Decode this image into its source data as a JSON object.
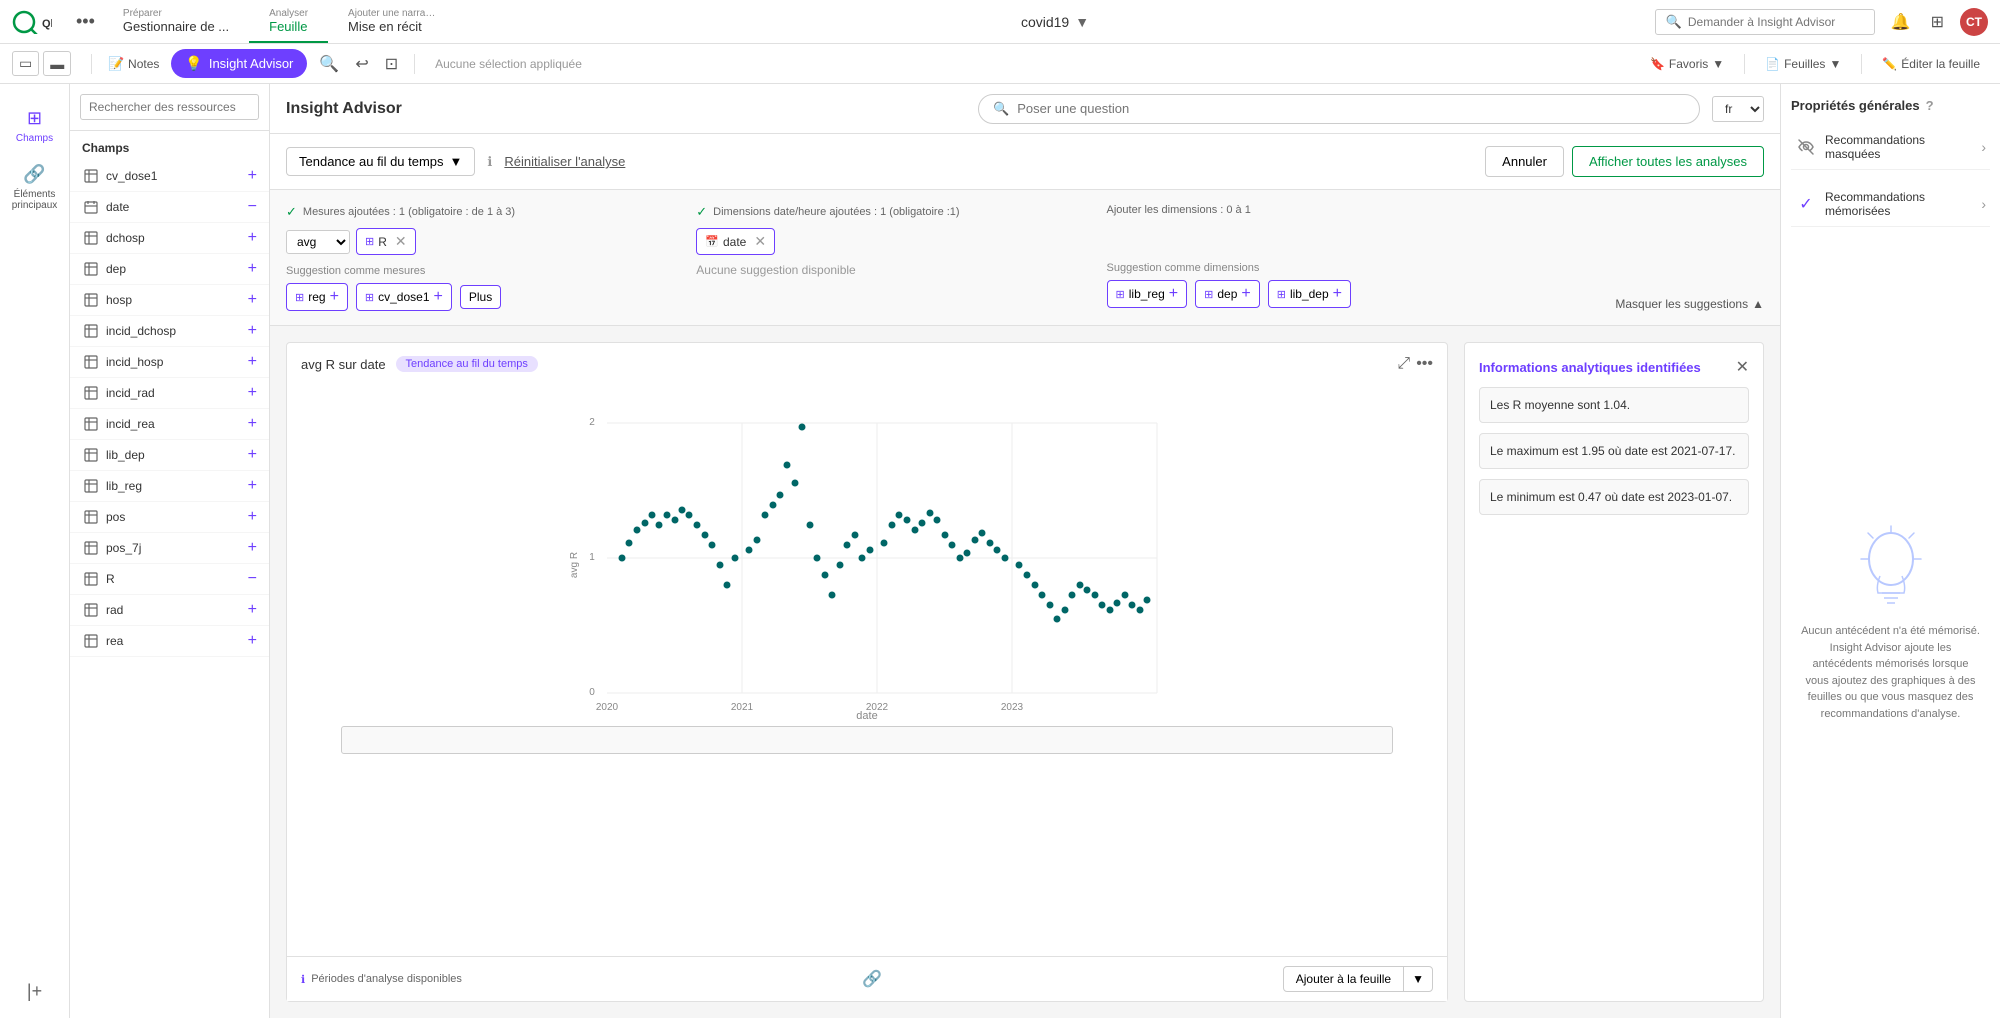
{
  "app": {
    "name": "covid19",
    "logo_text": "Qlik"
  },
  "top_bar": {
    "dots_label": "•••",
    "nav_items": [
      {
        "top": "Préparer",
        "main": "Gestionnaire de ...",
        "has_dropdown": true,
        "active": false
      },
      {
        "top": "Analyser",
        "main": "Feuille",
        "has_dropdown": false,
        "active": true
      },
      {
        "top": "Ajouter une narra…",
        "main": "Mise en récit",
        "has_dropdown": false,
        "active": false
      }
    ],
    "search_placeholder": "Demander à Insight Advisor",
    "lang": "fr",
    "avatar_initials": "CT"
  },
  "second_bar": {
    "notes_btn": "Notes",
    "insight_btn": "Insight Advisor",
    "no_selection": "Aucune sélection appliquée",
    "favoris_btn": "Favoris",
    "feuilles_btn": "Feuilles",
    "edit_btn": "Éditer la feuille"
  },
  "ia_header": {
    "title": "Insight Advisor",
    "search_placeholder": "Poser une question",
    "lang_option": "fr"
  },
  "sidebar": {
    "items": [
      {
        "icon": "⊞",
        "label": "Champs",
        "active": true
      },
      {
        "icon": "🔗",
        "label": "Éléments principaux",
        "active": false
      }
    ]
  },
  "fields_panel": {
    "search_placeholder": "Rechercher des ressources",
    "section_header": "Champs",
    "fields": [
      {
        "name": "cv_dose1",
        "icon": "table",
        "action": "plus"
      },
      {
        "name": "date",
        "icon": "calendar",
        "action": "minus"
      },
      {
        "name": "dchosp",
        "icon": "table",
        "action": "plus"
      },
      {
        "name": "dep",
        "icon": "table",
        "action": "plus"
      },
      {
        "name": "hosp",
        "icon": "table",
        "action": "plus"
      },
      {
        "name": "incid_dchosp",
        "icon": "table",
        "action": "plus"
      },
      {
        "name": "incid_hosp",
        "icon": "table",
        "action": "plus"
      },
      {
        "name": "incid_rad",
        "icon": "table",
        "action": "plus"
      },
      {
        "name": "incid_rea",
        "icon": "table",
        "action": "plus"
      },
      {
        "name": "lib_dep",
        "icon": "table",
        "action": "plus"
      },
      {
        "name": "lib_reg",
        "icon": "table",
        "action": "plus"
      },
      {
        "name": "pos",
        "icon": "table",
        "action": "plus"
      },
      {
        "name": "pos_7j",
        "icon": "table",
        "action": "plus"
      },
      {
        "name": "R",
        "icon": "table",
        "action": "minus"
      },
      {
        "name": "rad",
        "icon": "table",
        "action": "plus"
      },
      {
        "name": "rea",
        "icon": "table",
        "action": "plus"
      }
    ]
  },
  "analysis": {
    "type": "Tendance au fil du temps",
    "reset_label": "Réinitialiser l'analyse",
    "cancel_label": "Annuler",
    "show_all_label": "Afficher toutes les analyses",
    "measures_header": "Mesures ajoutées : 1 (obligatoire : de 1 à 3)",
    "date_header": "Dimensions date/heure ajoutées : 1 (obligatoire :1)",
    "add_dims_label": "Ajouter les dimensions : 0 à 1",
    "selected_measure_agg": "avg",
    "selected_measure": "R",
    "selected_date": "date",
    "suggestion_measures_label": "Suggestion comme mesures",
    "suggestion_dims_label": "Suggestion comme dimensions",
    "no_suggestion": "Aucune suggestion disponible",
    "suggestion_measures": [
      "reg",
      "cv_dose1"
    ],
    "suggestion_dims": [
      "lib_reg",
      "dep",
      "lib_dep"
    ],
    "plus_label": "Plus",
    "hide_suggestions": "Masquer les suggestions"
  },
  "chart": {
    "title": "avg R sur date",
    "badge": "Tendance au fil du temps",
    "x_label": "date",
    "y_label": "avg R",
    "y_max": 2,
    "y_mid": 1,
    "y_min": 0,
    "x_labels": [
      "2020",
      "2021",
      "2022",
      "2023"
    ],
    "periods_label": "Périodes d'analyse disponibles",
    "add_sheet_label": "Ajouter à la feuille"
  },
  "insights": {
    "title": "Informations analytiques identifiées",
    "items": [
      "Les R moyenne sont 1.04.",
      "Le maximum est 1.95 où date est 2021-07-17.",
      "Le minimum est 0.47 où date est 2023-01-07."
    ]
  },
  "right_panel": {
    "title": "Propriétés générales",
    "items": [
      {
        "icon": "eye-off",
        "label": "Recommandations masquées",
        "has_check": false
      },
      {
        "icon": "check",
        "label": "Recommandations mémorisées",
        "has_check": true
      }
    ],
    "bulb_text": "Aucun antécédent n'a été mémorisé. Insight Advisor ajoute les antécédents mémorisés lorsque vous ajoutez des graphiques à des feuilles ou que vous masquez des recommandations d'analyse."
  }
}
